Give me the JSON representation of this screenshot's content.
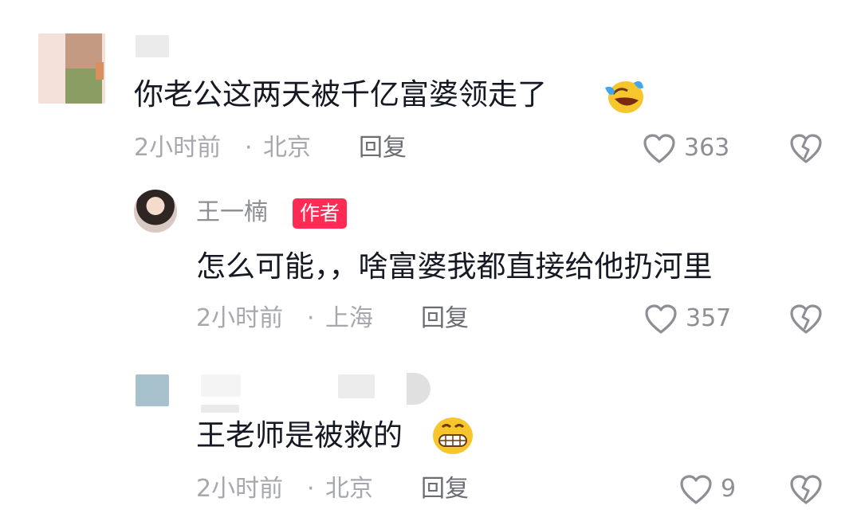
{
  "comments": [
    {
      "text": "你老公这两天被千亿富婆领走了",
      "time": "2小时前",
      "separator": "·",
      "location": "北京",
      "reply_label": "回复",
      "like_count": "363",
      "emoji": "laughing-tears-emoji"
    },
    {
      "username": "王一楠",
      "author_badge": "作者",
      "text": "怎么可能，，啥富婆我都直接给他扔河里",
      "time": "2小时前",
      "separator": "·",
      "location": "上海",
      "reply_label": "回复",
      "like_count": "357"
    },
    {
      "text": "王老师是被救的",
      "time": "2小时前",
      "separator": "·",
      "location": "北京",
      "reply_label": "回复",
      "like_count": "9",
      "emoji": "grinning-emoji"
    }
  ],
  "icons": {
    "like": "heart-outline-icon",
    "dislike": "broken-heart-icon"
  },
  "colors": {
    "text": "#161823",
    "meta": "#a6a8ad",
    "badge": "#fe2c55"
  }
}
